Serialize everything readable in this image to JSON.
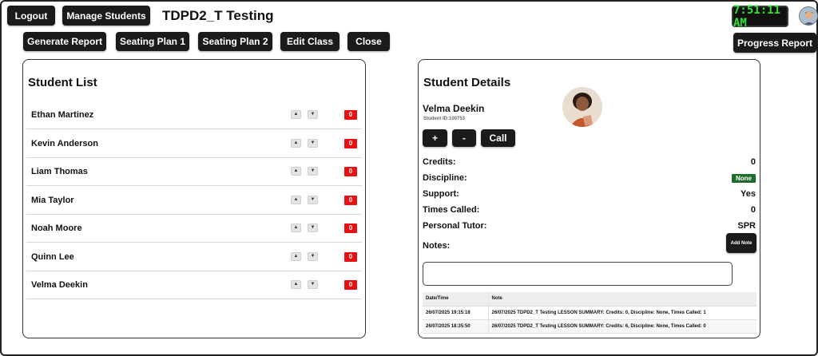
{
  "header": {
    "logout_label": "Logout",
    "manage_students_label": "Manage Students",
    "class_title": "TDPD2_T Testing",
    "clock": "7:51:11 AM",
    "progress_report_label": "Progress Report"
  },
  "toolbar": {
    "generate_report_label": "Generate Report",
    "seating_plan_1_label": "Seating Plan 1",
    "seating_plan_2_label": "Seating Plan 2",
    "edit_class_label": "Edit Class",
    "close_label": "Close"
  },
  "student_list": {
    "title": "Student List",
    "up_glyph": "▲",
    "down_glyph": "▼",
    "students": [
      {
        "name": "Ethan Martinez",
        "credits": "0"
      },
      {
        "name": "Kevin Anderson",
        "credits": "0"
      },
      {
        "name": "Liam Thomas",
        "credits": "0"
      },
      {
        "name": "Mia Taylor",
        "credits": "0"
      },
      {
        "name": "Noah Moore",
        "credits": "0"
      },
      {
        "name": "Quinn Lee",
        "credits": "0"
      },
      {
        "name": "Velma Deekin",
        "credits": "0"
      }
    ]
  },
  "student_details": {
    "title": "Student Details",
    "name": "Velma Deekin",
    "student_id": "Student ID:100753",
    "plus_label": "+",
    "minus_label": "-",
    "call_label": "Call",
    "fields": {
      "credits_label": "Credits:",
      "credits_value": "0",
      "discipline_label": "Discipline:",
      "discipline_value": "None",
      "support_label": "Support:",
      "support_value": "Yes",
      "times_called_label": "Times Called:",
      "times_called_value": "0",
      "personal_tutor_label": "Personal Tutor:",
      "personal_tutor_value": "SPR",
      "notes_label": "Notes:"
    },
    "add_note_label": "Add Note",
    "notes_input_value": "",
    "notes_table": {
      "headers": [
        "Date/Time",
        "Note"
      ],
      "rows": [
        [
          "26/07/2025 19:15:18",
          "26/07/2025 TDPD2_T Testing LESSON SUMMARY: Credits: 0, Discipline: None, Times Called: 1"
        ],
        [
          "26/07/2025 18:35:50",
          "26/07/2025 TDPD2_T Testing LESSON SUMMARY: Credits: 6, Discipline: None, Times Called: 0"
        ]
      ]
    }
  },
  "colors": {
    "button_bg": "#1b1b1b",
    "clock_text": "#2ee62e",
    "credit_badge": "#e81010",
    "discipline_badge": "#1e6b2a"
  }
}
